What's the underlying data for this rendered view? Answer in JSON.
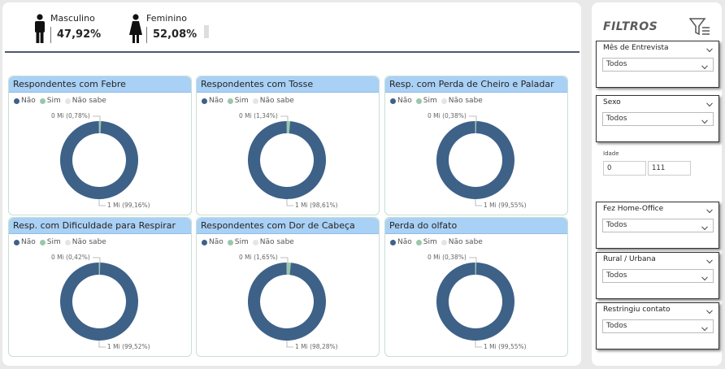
{
  "demographics": {
    "male": {
      "label": "Masculino",
      "value": "47,92%",
      "icon": "male-person-icon"
    },
    "female": {
      "label": "Feminino",
      "value": "52,08%",
      "icon": "female-person-icon"
    }
  },
  "colors": {
    "nao": "#3e6188",
    "sim": "#98c8a8",
    "nao_sabe": "#e5e5e5",
    "title_bg": "#a9d0f5"
  },
  "legend": {
    "nao": "Não",
    "sim": "Sim",
    "nao_sabe": "Não sabe"
  },
  "chart_data": [
    {
      "type": "pie",
      "title": "Respondentes com Febre",
      "categories": [
        "Não",
        "Sim",
        "Não sabe"
      ],
      "values": [
        99.16,
        0.78,
        0.06
      ],
      "label_sim": "0 Mi (0,78%)",
      "label_nao": "1 Mi (99,16%)"
    },
    {
      "type": "pie",
      "title": "Respondentes com Tosse",
      "categories": [
        "Não",
        "Sim",
        "Não sabe"
      ],
      "values": [
        98.61,
        1.34,
        0.05
      ],
      "label_sim": "0 Mi (1,34%)",
      "label_nao": "1 Mi (98,61%)"
    },
    {
      "type": "pie",
      "title": "Resp. com Perda de Cheiro e Paladar",
      "categories": [
        "Não",
        "Sim",
        "Não sabe"
      ],
      "values": [
        99.55,
        0.38,
        0.07
      ],
      "label_sim": "0 Mi (0,38%)",
      "label_nao": "1 Mi (99,55%)"
    },
    {
      "type": "pie",
      "title": "Resp. com Dificuldade para Respirar",
      "categories": [
        "Não",
        "Sim",
        "Não sabe"
      ],
      "values": [
        99.52,
        0.42,
        0.06
      ],
      "label_sim": "0 Mi (0,42%)",
      "label_nao": "1 Mi (99,52%)"
    },
    {
      "type": "pie",
      "title": "Respondentes com Dor de Cabeça",
      "categories": [
        "Não",
        "Sim",
        "Não sabe"
      ],
      "values": [
        98.28,
        1.65,
        0.07
      ],
      "label_sim": "0 Mi (1,65%)",
      "label_nao": "1 Mi (98,28%)"
    },
    {
      "type": "pie",
      "title": "Perda do olfato",
      "categories": [
        "Não",
        "Sim",
        "Não sabe"
      ],
      "values": [
        99.55,
        0.38,
        0.07
      ],
      "label_sim": "0 Mi (0,38%)",
      "label_nao": "1 Mi (99,55%)"
    }
  ],
  "filters": {
    "title": "FILTROS",
    "slicers": [
      {
        "label": "Mês de Entrevista",
        "value": "Todos"
      },
      {
        "label": "Sexo",
        "value": "Todos"
      },
      {
        "label": "Fez Home-Office",
        "value": "Todos"
      },
      {
        "label": "Rural / Urbana",
        "value": "Todos"
      },
      {
        "label": "Restringiu contato",
        "value": "Todos"
      }
    ],
    "idade": {
      "label": "Idade",
      "min": "0",
      "max": "111"
    }
  }
}
